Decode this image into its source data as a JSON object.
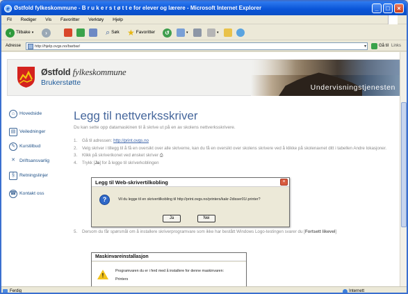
{
  "window": {
    "title": "Østfold fylkeskommune - B r u k e r s t ø t t e  for elever og lærere - Microsoft Internet Explorer",
    "minimize": "_",
    "maximize": "□",
    "close": "×"
  },
  "menu": [
    "Fil",
    "Rediger",
    "Vis",
    "Favoritter",
    "Verktøy",
    "Hjelp"
  ],
  "toolbar": {
    "back_label": "Tilbake",
    "search_label": "Søk",
    "favorites_label": "Favoritter"
  },
  "address": {
    "label": "Adresse",
    "url": "http://hjelp.ovgs.no/barbar/",
    "go_label": "Gå til",
    "links_label": "Links"
  },
  "header": {
    "org_bold": "Østfold",
    "org_italic": "fylkeskommune",
    "site": "Brukerstøtte",
    "banner_text": "Undervisningstjenesten"
  },
  "nav": {
    "items": [
      {
        "label": "Hovedside",
        "icon": "home-icon",
        "glyph": "⌂"
      },
      {
        "label": "Veiledninger",
        "icon": "book-icon",
        "glyph": "▤"
      },
      {
        "label": "Kurstilbud",
        "icon": "pencil-icon",
        "glyph": "✎"
      },
      {
        "label": "Driftsansvarlig",
        "icon": "tools-icon",
        "glyph": "✕"
      },
      {
        "label": "Retningslinjer",
        "icon": "paragraph-icon",
        "glyph": "§"
      },
      {
        "label": "Kontakt oss",
        "icon": "contact-icon",
        "glyph": "☎"
      }
    ]
  },
  "main": {
    "title": "Legg til nettverksskriver",
    "lead": "Du kan sette opp datamaskinen til å skrive ut på en av skolens nettverksskrivere.",
    "step1_pre": "Gå til adressen: ",
    "step1_link": "http://print.ovgs.no",
    "step2": "Velg skriver i tillegg til å få en oversikt over alle skriverne, kan du få en oversikt over skolens skrivere ved å klikke på skolenavnet ditt i tabellen Andre lokasjoner.",
    "step3": "Klikk på skriverikonet ved ønsket skriver",
    "step4_pre": "Trykk [",
    "step4_bold": "Ja",
    "step4_post": "] for å legge til skriverkoblingen",
    "step5_pre": "Dersom du får spørsmål om å installere skriverprogramvare som ikke har bestått Windows Logo-testingen svarer du [",
    "step5_bold": "Fortsett likevel",
    "step5_post": "]"
  },
  "dialog1": {
    "title": "Legg til Web-skrivertilkobling",
    "message": "Vil du legge til en skrivertilkobling til http://print.ovgs.no/printers/kakr-2disser01/.printer?",
    "yes": "Ja",
    "no": "Nei"
  },
  "dialog2": {
    "title": "Maskinvareinstallasjon",
    "line1": "Programvaren du er i ferd med å installere for denne maskinvaren:",
    "line2": "Printers"
  },
  "status": {
    "left": "Ferdig",
    "zone": "Internett"
  }
}
